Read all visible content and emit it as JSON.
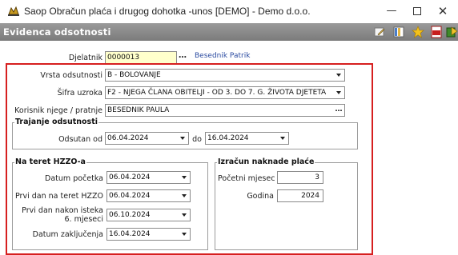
{
  "window": {
    "title": "Saop Obračun plaća i drugog dohotka -unos [DEMO] - Demo d.o.o.",
    "minimize_icon": "minimize-icon",
    "maximize_icon": "maximize-icon",
    "close_icon": "close-icon"
  },
  "header": {
    "title": "Evidenca odsotnosti",
    "icons": [
      "edit-icon",
      "columns-icon",
      "star-icon",
      "pdf-icon",
      "export-icon"
    ]
  },
  "form": {
    "djelatnik_label": "Djelatnik",
    "djelatnik_value": "0000013",
    "djelatnik_name": "Besednik Patrik",
    "vrsta_label": "Vrsta odsutnosti",
    "vrsta_value": "B - BOLOVANJE",
    "sifra_label": "Šifra uzroka",
    "sifra_value": "F2 - NJEGA ČLANA OBITELJI - OD 3. DO 7. G. ŽIVOTA DJETETA",
    "korisnik_label": "Korisnik njege / pratnje",
    "korisnik_value": "BESEDNIK PAULA"
  },
  "trajanje": {
    "legend": "Trajanje odsutnosti",
    "odsutan_label": "Odsutan od",
    "od_value": "06.04.2024",
    "do_label": "do",
    "do_value": "16.04.2024"
  },
  "hzzo": {
    "legend": "Na teret HZZO-a",
    "datum_pocetka_label": "Datum početka",
    "datum_pocetka_value": "06.04.2024",
    "prvi_dan_label": "Prvi dan na teret HZZO",
    "prvi_dan_value": "06.04.2024",
    "prvi_dan_nakon_label_1": "Prvi dan nakon isteka",
    "prvi_dan_nakon_label_2": "6. mjeseci",
    "prvi_dan_nakon_value": "06.10.2024",
    "datum_zakljucenja_label": "Datum zaključenja",
    "datum_zakljucenja_value": "16.04.2024"
  },
  "izracun": {
    "legend": "Izračun naknade plaće",
    "pocetni_mjesec_label": "Početni mjesec",
    "pocetni_mjesec_value": "3",
    "godina_label": "Godina",
    "godina_value": "2024"
  }
}
